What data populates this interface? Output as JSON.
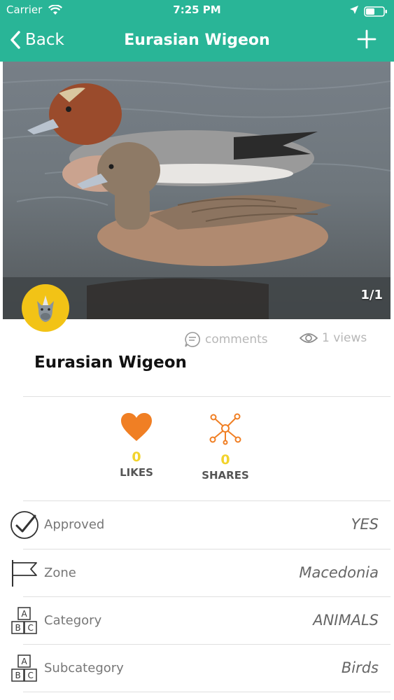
{
  "status_bar": {
    "carrier": "Carrier",
    "time": "7:25 PM"
  },
  "nav": {
    "back_label": "Back",
    "title": "Eurasian Wigeon"
  },
  "photo": {
    "counter": "1/1"
  },
  "meta": {
    "comments": "comments",
    "views": "1 views"
  },
  "item": {
    "name": "Eurasian Wigeon"
  },
  "stats": [
    {
      "count": "0",
      "label": "LIKES",
      "icon": "heart-icon",
      "color": "#f07f24"
    },
    {
      "count": "0",
      "label": "SHARES",
      "icon": "share-network-icon",
      "color": "#f07f24"
    }
  ],
  "details": [
    {
      "icon": "check-circle-icon",
      "label": "Approved",
      "value": "YES"
    },
    {
      "icon": "flag-icon",
      "label": "Zone",
      "value": "Macedonia"
    },
    {
      "icon": "abc-blocks-icon",
      "label": "Category",
      "value": "ANIMALS"
    },
    {
      "icon": "abc-blocks-icon",
      "label": "Subcategory",
      "value": "Birds"
    }
  ],
  "colors": {
    "header": "#29b597",
    "accent": "#f07f24",
    "count": "#f2d32c",
    "avatar": "#f2c316"
  }
}
